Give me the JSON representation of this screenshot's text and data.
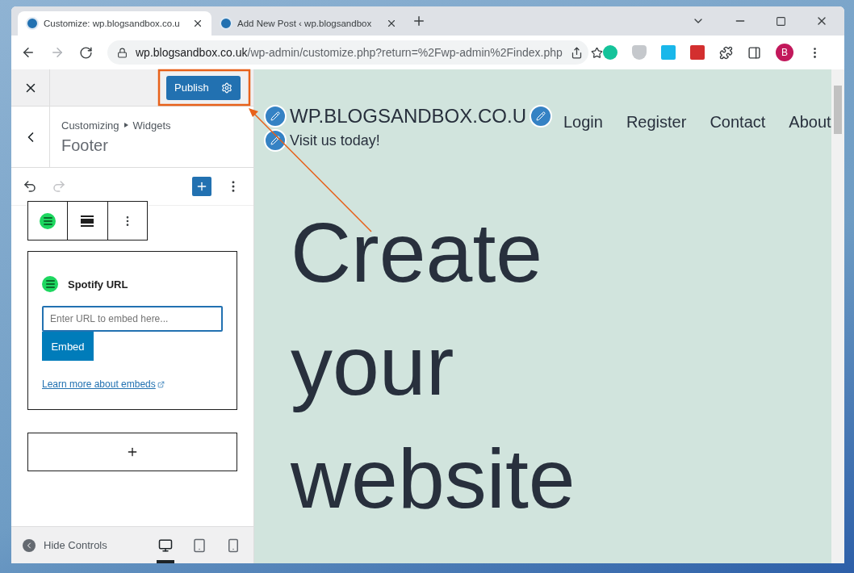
{
  "browser": {
    "tabs": [
      {
        "title": "Customize: wp.blogsandbox.co.u",
        "selected": true
      },
      {
        "title": "Add New Post ‹ wp.blogsandbox",
        "selected": false
      }
    ],
    "address": {
      "host": "wp.blogsandbox.co.uk",
      "path": "/wp-admin/customize.php?return=%2Fwp-admin%2Findex.php"
    },
    "profile": "B"
  },
  "sidebar": {
    "publish": "Publish",
    "breadcrumb": [
      "Customizing",
      "Widgets"
    ],
    "section_title": "Footer",
    "block": {
      "title": "Spotify URL",
      "placeholder": "Enter URL to embed here...",
      "button": "Embed",
      "link": "Learn more about embeds"
    },
    "footer": {
      "label": "Hide Controls",
      "devices": [
        {
          "kind": "desktop",
          "selected": true
        },
        {
          "kind": "tablet",
          "selected": false
        },
        {
          "kind": "mobile",
          "selected": false
        }
      ]
    }
  },
  "preview": {
    "site_title": "WP.BLOGSANDBOX.CO.U",
    "tagline": "Visit us today!",
    "nav": [
      "Login",
      "Register",
      "Contact",
      "About"
    ],
    "heading": [
      "Create",
      "your",
      "website"
    ]
  }
}
